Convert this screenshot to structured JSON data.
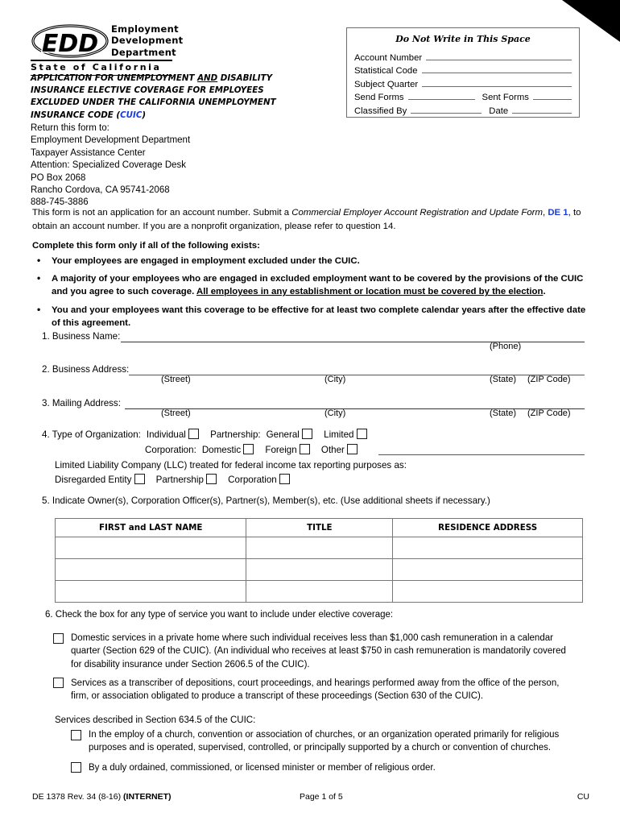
{
  "logo": {
    "mark_text": "EDD",
    "words": [
      "Employment",
      "Development",
      "Department"
    ],
    "state_line": "State of California"
  },
  "title": {
    "line1_a": "APPLICATION FOR UNEMPLOYMENT ",
    "line1_and": "AND",
    "line1_b": " DISABILITY",
    "line2": "INSURANCE ELECTIVE COVERAGE FOR EMPLOYEES",
    "line3": "EXCLUDED UNDER THE CALIFORNIA UNEMPLOYMENT",
    "line4_a": "INSURANCE CODE (",
    "line4_link": "CUIC",
    "line4_b": ")"
  },
  "return_address": {
    "intro": "Return this form to:",
    "lines": [
      "Employment Development Department",
      "Taxpayer Assistance Center",
      "Attention: Specialized Coverage Desk",
      "PO Box 2068",
      "Rancho Cordova, CA 95741-2068",
      "888-745-3886"
    ]
  },
  "do_not_write": {
    "title": "Do Not Write in This Space",
    "rows": [
      {
        "label": "Account Number"
      },
      {
        "label": "Statistical Code"
      },
      {
        "label": "Subject Quarter"
      },
      {
        "label": "Send Forms",
        "label2": "Sent Forms"
      },
      {
        "label": "Classified By",
        "label2": "Date"
      }
    ]
  },
  "intro_paragraph": {
    "part1": "This form is not an application for an account number. Submit a ",
    "italic": "Commercial Employer Account Registration and Update Form",
    "comma": ", ",
    "link": "DE 1",
    "part2": ", to obtain an account number. If you are a nonprofit organization, please refer to question 14."
  },
  "complete_heading": "Complete this form only if all of the following exists:",
  "bullets": [
    {
      "text": "Your employees are engaged in employment excluded under the CUIC."
    },
    {
      "text_a": "A majority of your employees who are engaged in excluded employment want to be covered by the provisions of the CUIC and you agree to such coverage. ",
      "underline": "All employees in any establishment or location must be covered by the election",
      "text_b": "."
    },
    {
      "text": "You and your employees want this coverage to be effective for at least two complete calendar years after the effective date of this agreement."
    }
  ],
  "fields": {
    "q1_label": "1.  Business Name:",
    "q1_sub": "(Phone)",
    "q2_label": "2.  Business Address:",
    "q3_label": "3.  Mailing Address:",
    "addr_sub": {
      "street": "(Street)",
      "city": "(City)",
      "state": "(State)",
      "zip": "(ZIP Code)"
    }
  },
  "q4": {
    "label": "4.  Type of Organization:",
    "individual": "Individual",
    "partnership": "Partnership:",
    "general": "General",
    "limited": "Limited",
    "corporation": "Corporation:",
    "domestic": "Domestic",
    "foreign": "Foreign",
    "other": "Other",
    "llc_text": "Limited Liability Company (LLC) treated for federal income tax reporting purposes as:",
    "disregarded": "Disregarded Entity",
    "llc_partnership": "Partnership",
    "llc_corporation": "Corporation"
  },
  "q5": {
    "label": "5.  Indicate Owner(s), Corporation Officer(s), Partner(s), Member(s), etc. (Use additional sheets if necessary.)",
    "columns": [
      "FIRST and LAST NAME",
      "TITLE",
      "RESIDENCE ADDRESS"
    ],
    "rows": [
      [
        "",
        "",
        ""
      ],
      [
        "",
        "",
        ""
      ],
      [
        "",
        "",
        ""
      ]
    ]
  },
  "q6": {
    "label": "6.  Check the box for any type of service you want to include under elective coverage:",
    "items": [
      {
        "text": "Domestic services in a private home where such individual receives less than $1,000 cash remuneration in a calendar quarter (Section 629 of the CUIC). (An individual who receives at least $750 in cash remuneration is mandatorily covered for disability insurance under Section 2606.5 of the CUIC)."
      },
      {
        "text": "Services as a transcriber of depositions, court proceedings, and hearings performed away from the office of the person, firm, or association obligated to produce a transcript of these proceedings (Section 630 of the CUIC)."
      }
    ],
    "sub_heading": "Services described in Section 634.5 of the CUIC:",
    "sub_items": [
      {
        "text": "In the employ of a church, convention or association of churches, or an organization operated primarily for religious purposes and is operated, supervised, controlled, or principally supported by a church or convention of churches."
      },
      {
        "text": "By a duly ordained, commissioned, or licensed minister or member of religious order."
      }
    ]
  },
  "footer": {
    "left_a": "DE 1378 Rev. 34 (8-16) ",
    "left_b": "(INTERNET)",
    "center": "Page 1 of 5",
    "right": "CU"
  },
  "colors": {
    "link": "#1a3fd0",
    "rule": "#555555",
    "border": "#777777"
  }
}
